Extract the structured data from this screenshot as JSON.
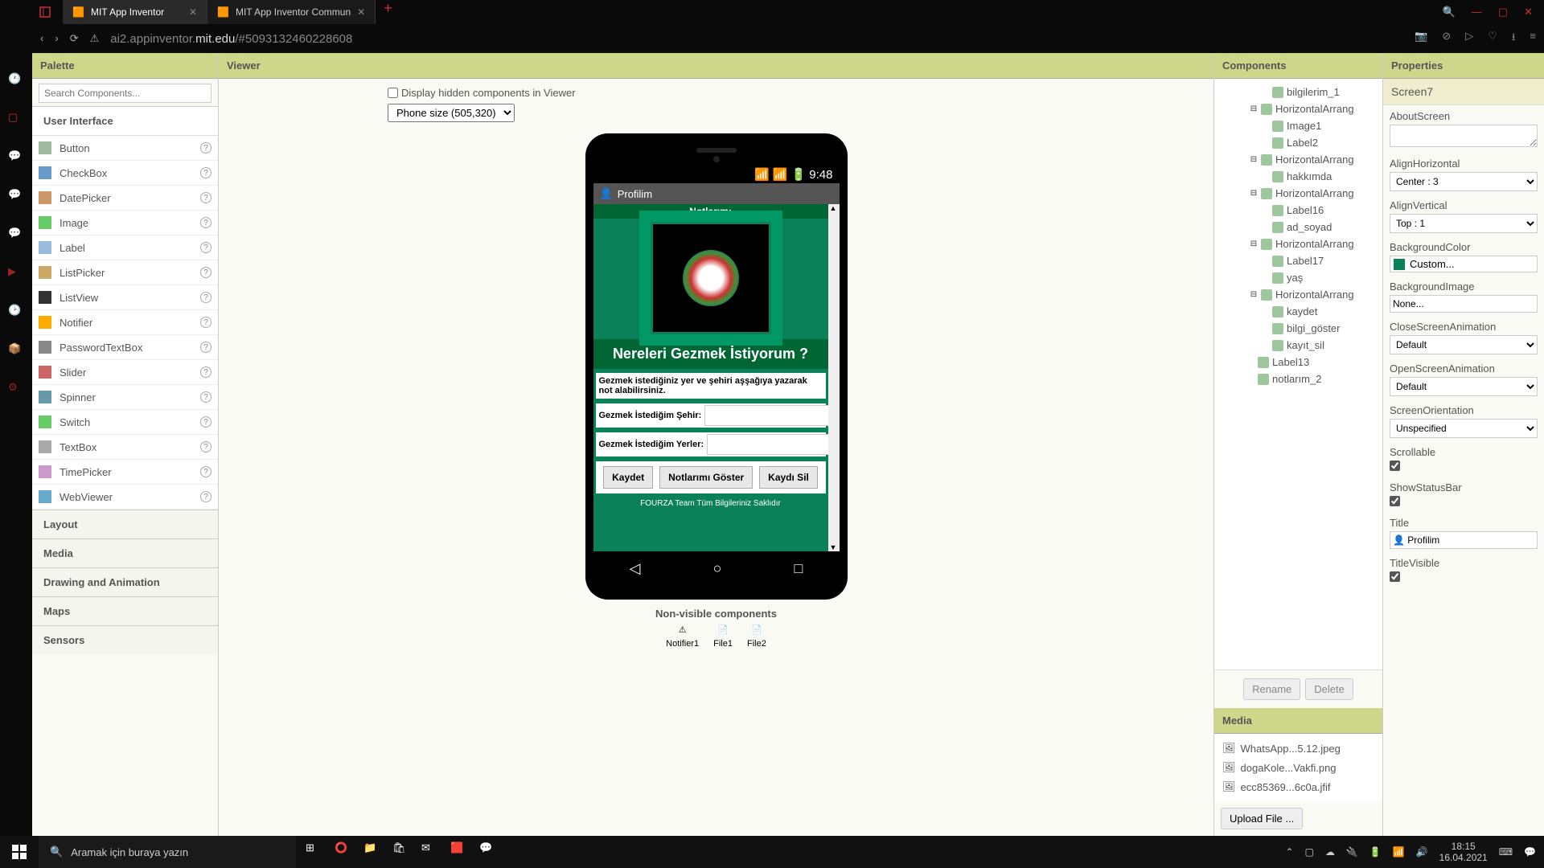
{
  "browser": {
    "tabs": [
      {
        "title": "MIT App Inventor",
        "active": true
      },
      {
        "title": "MIT App Inventor Commun",
        "active": false
      }
    ],
    "url_prefix": "ai2.appinventor.",
    "url_domain": "mit.edu",
    "url_path": "/#5093132460228608"
  },
  "palette": {
    "header": "Palette",
    "search_placeholder": "Search Components...",
    "category": "User Interface",
    "items": [
      "Button",
      "CheckBox",
      "DatePicker",
      "Image",
      "Label",
      "ListPicker",
      "ListView",
      "Notifier",
      "PasswordTextBox",
      "Slider",
      "Spinner",
      "Switch",
      "TextBox",
      "TimePicker",
      "WebViewer"
    ],
    "other_categories": [
      "Layout",
      "Media",
      "Drawing and Animation",
      "Maps",
      "Sensors"
    ]
  },
  "viewer": {
    "header": "Viewer",
    "hidden_label": "Display hidden components in Viewer",
    "size_option": "Phone size (505,320)",
    "status_time": "9:48",
    "title": "Profilim",
    "notlarim": "Notlarım:",
    "heading": "Nereleri Gezmek İstiyorum ?",
    "info": "Gezmek istediğiniz yer ve şehiri aşşağıya yazarak not alabilirsiniz.",
    "input1_label": "Gezmek İstediğim Şehir:",
    "input2_label": "Gezmek İstediğim Yerler:",
    "btn_save": "Kaydet",
    "btn_show": "Notlarımı Göster",
    "btn_delete": "Kaydı Sil",
    "footer": "FOURZA Team Tüm Bilgileriniz Saklıdır",
    "non_visible_header": "Non-visible components",
    "nv_items": [
      "Notifier1",
      "File1",
      "File2"
    ]
  },
  "components": {
    "header": "Components",
    "tree": [
      {
        "name": "bilgilerim_1",
        "indent": 2,
        "type": "label"
      },
      {
        "name": "HorizontalArrang",
        "indent": 1,
        "type": "layout",
        "expanded": true
      },
      {
        "name": "Image1",
        "indent": 2,
        "type": "image"
      },
      {
        "name": "Label2",
        "indent": 2,
        "type": "label"
      },
      {
        "name": "HorizontalArrang",
        "indent": 1,
        "type": "layout",
        "expanded": true
      },
      {
        "name": "hakkımda",
        "indent": 2,
        "type": "label"
      },
      {
        "name": "HorizontalArrang",
        "indent": 1,
        "type": "layout",
        "expanded": true
      },
      {
        "name": "Label16",
        "indent": 2,
        "type": "label"
      },
      {
        "name": "ad_soyad",
        "indent": 2,
        "type": "text"
      },
      {
        "name": "HorizontalArrang",
        "indent": 1,
        "type": "layout",
        "expanded": true
      },
      {
        "name": "Label17",
        "indent": 2,
        "type": "label"
      },
      {
        "name": "yaş",
        "indent": 2,
        "type": "text"
      },
      {
        "name": "HorizontalArrang",
        "indent": 1,
        "type": "layout",
        "expanded": true
      },
      {
        "name": "kaydet",
        "indent": 2,
        "type": "button"
      },
      {
        "name": "bilgi_göster",
        "indent": 2,
        "type": "button"
      },
      {
        "name": "kayıt_sil",
        "indent": 2,
        "type": "button"
      },
      {
        "name": "Label13",
        "indent": 0,
        "type": "label"
      },
      {
        "name": "notlarım_2",
        "indent": 0,
        "type": "label"
      }
    ],
    "rename": "Rename",
    "delete": "Delete",
    "media_header": "Media",
    "media_items": [
      "WhatsApp...5.12.jpeg",
      "dogaKole...Vakfi.png",
      "ecc85369...6c0a.jfif"
    ],
    "upload": "Upload File ..."
  },
  "properties": {
    "header": "Properties",
    "screen": "Screen7",
    "fields": {
      "AboutScreen": "",
      "AlignHorizontal": "Center : 3",
      "AlignVertical": "Top : 1",
      "BackgroundColor": "Custom...",
      "BackgroundImage": "None...",
      "CloseScreenAnimation": "Default",
      "OpenScreenAnimation": "Default",
      "ScreenOrientation": "Unspecified",
      "Scrollable": true,
      "ShowStatusBar": true,
      "Title": "Profilim",
      "TitleVisible": true
    }
  },
  "taskbar": {
    "search_placeholder": "Aramak için buraya yazın",
    "time": "18:15",
    "date": "16.04.2021"
  }
}
